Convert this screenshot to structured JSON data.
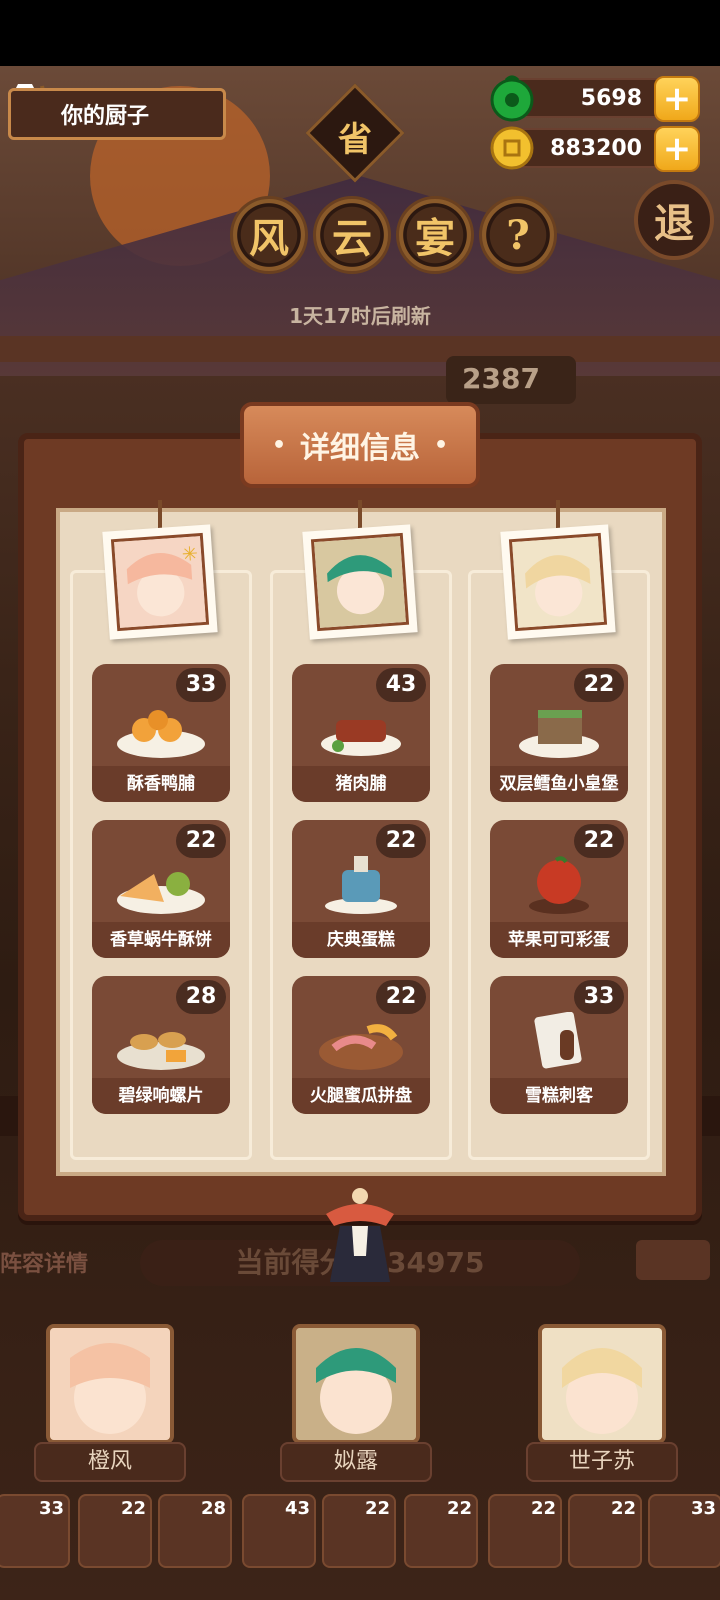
{
  "player": {
    "chef_label": "你的厨子"
  },
  "currency": {
    "jade": "5698",
    "coins": "883200"
  },
  "title": {
    "region": "省",
    "chars": [
      "风",
      "云",
      "宴"
    ],
    "help": "?"
  },
  "exit_label": "退",
  "refresh_text": "1天17时后刷新",
  "score_peek": "2387",
  "modal": {
    "title": "详细信息",
    "columns": [
      {
        "chef": "橙风",
        "dishes": [
          {
            "name": "酥香鸭脯",
            "count": "33"
          },
          {
            "name": "香草蜗牛酥饼",
            "count": "22"
          },
          {
            "name": "碧绿响螺片",
            "count": "28"
          }
        ]
      },
      {
        "chef": "姒露",
        "dishes": [
          {
            "name": "猪肉脯",
            "count": "43"
          },
          {
            "name": "庆典蛋糕",
            "count": "22"
          },
          {
            "name": "火腿蜜瓜拼盘",
            "count": "22"
          }
        ]
      },
      {
        "chef": "世子苏",
        "dishes": [
          {
            "name": "双层鳕鱼小皇堡",
            "count": "22"
          },
          {
            "name": "苹果可可彩蛋",
            "count": "22"
          },
          {
            "name": "雪糕刺客",
            "count": "33"
          }
        ]
      }
    ]
  },
  "bottom": {
    "lineup_label": "阵容详情",
    "current_score_label": "当前得分",
    "current_score_value": "434975",
    "chefs": [
      "橙风",
      "姒露",
      "世子苏"
    ],
    "strip_counts": [
      "33",
      "22",
      "28",
      "43",
      "22",
      "22",
      "22",
      "22",
      "33"
    ]
  },
  "colors": {
    "accent": "#f0a81a",
    "frame": "#6e3a24",
    "panel": "#e9d9c1",
    "card": "#7a4a36"
  }
}
